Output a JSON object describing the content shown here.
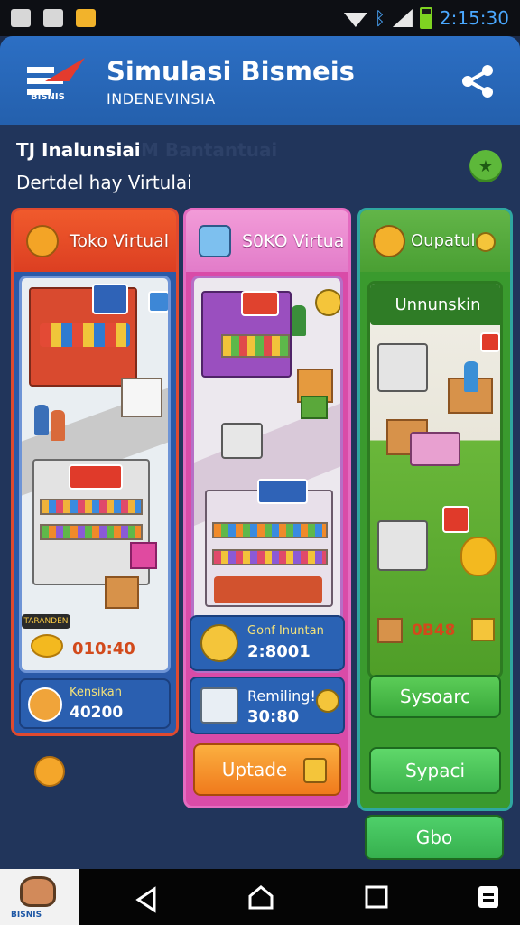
{
  "status_bar": {
    "time": "2:15:30"
  },
  "header": {
    "title": "Simulasi Bismeis",
    "subtitle": "INDENEVINSIA",
    "logo_tag": "BISNIS",
    "share_icon": "share-icon"
  },
  "intro": {
    "line1": "TJ Inalunsiai",
    "line1_faded": "M Bantantuai",
    "line2": "Dertdel hay Virtulai"
  },
  "columns": [
    {
      "label": "Toko Virtual",
      "icon": "box-icon",
      "ribbon": "TARANDEN",
      "price": "010:40",
      "stat_label": "Kensikan",
      "stat_value": "40200"
    },
    {
      "label": "S0KO Virtua",
      "icon": "cube-icon",
      "stat1_label": "Gonf Inuntan",
      "stat1_value": "2:8001",
      "stat2_label": "Remiling!",
      "stat2_value": "30:80",
      "button": "Uptade"
    },
    {
      "label": "Oupatul",
      "icon": "bag-icon",
      "banner": "Unnunskin",
      "price": "0B48",
      "button1": "Sysoarc",
      "button2": "Sypaci",
      "button3": "Gbo"
    }
  ],
  "nav": {
    "thumb_label": "BISNIS"
  },
  "colors": {
    "header": "#2c6fc4",
    "background": "#21355b",
    "accent_orange": "#f28a1c",
    "accent_green": "#4cc35a"
  }
}
